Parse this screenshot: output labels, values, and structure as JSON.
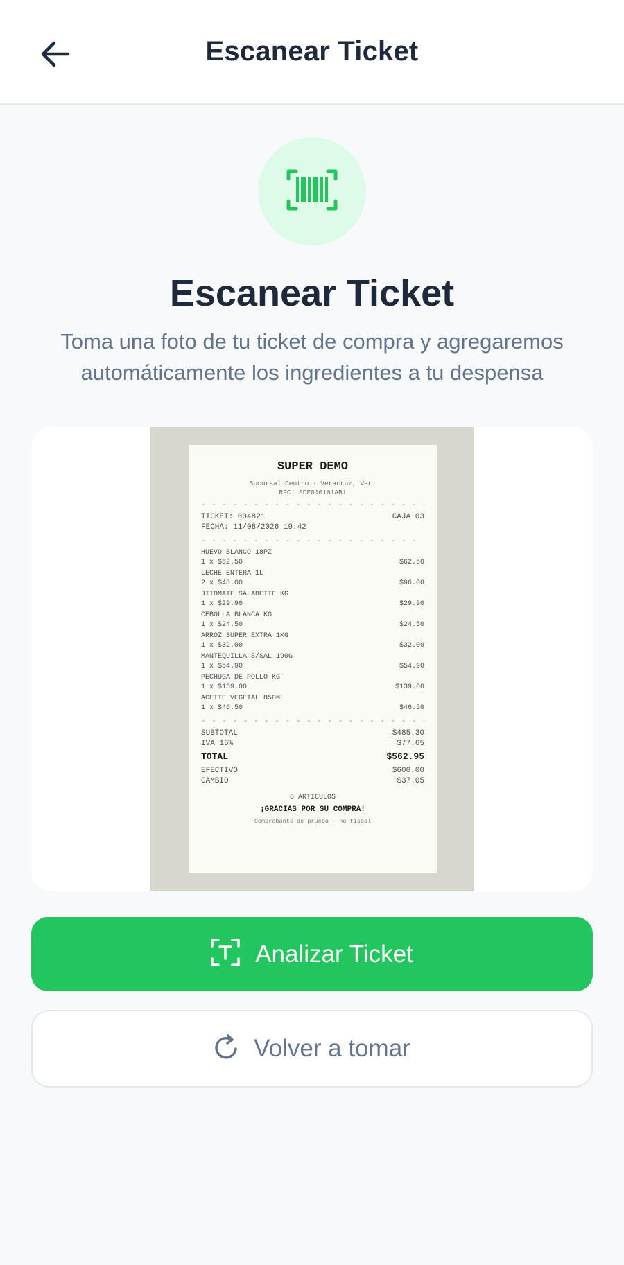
{
  "header": {
    "title": "Escanear Ticket",
    "back_icon": "arrow-left-icon"
  },
  "hero": {
    "icon": "barcode-scan-icon",
    "title": "Escanear Ticket",
    "subtitle": "Toma una foto de tu ticket de compra y agregaremos automáticamente los ingredientes a tu despensa"
  },
  "receipt": {
    "store": "SUPER DEMO",
    "branch": "Sucursal Centro · Veracruz, Ver.",
    "rfc": "RFC: SDE010101AB1",
    "divider": "- - - - - - - - - - - - - - - - - - - - - - -",
    "ticket": "TICKET: 004821",
    "register": "CAJA 03",
    "date": "FECHA: 11/08/2026 19:42",
    "items": [
      {
        "name": "HUEVO BLANCO 18PZ",
        "qty": "1 x $62.50",
        "amount": "$62.50"
      },
      {
        "name": "LECHE ENTERA 1L",
        "qty": "2 x $48.00",
        "amount": "$96.00"
      },
      {
        "name": "JITOMATE SALADETTE KG",
        "qty": "1 x $29.90",
        "amount": "$29.90"
      },
      {
        "name": "CEBOLLA BLANCA KG",
        "qty": "1 x $24.50",
        "amount": "$24.50"
      },
      {
        "name": "ARROZ SUPER EXTRA 1KG",
        "qty": "1 x $32.00",
        "amount": "$32.00"
      },
      {
        "name": "MANTEQUILLA S/SAL 190G",
        "qty": "1 x $54.90",
        "amount": "$54.90"
      },
      {
        "name": "PECHUGA DE POLLO KG",
        "qty": "1 x $139.00",
        "amount": "$139.00"
      },
      {
        "name": "ACEITE VEGETAL 850ML",
        "qty": "1 x $46.50",
        "amount": "$46.50"
      }
    ],
    "subtotal_label": "SUBTOTAL",
    "subtotal": "$485.30",
    "iva_label": "IVA 16%",
    "iva": "$77.65",
    "total_label": "TOTAL",
    "total": "$562.95",
    "cash_label": "EFECTIVO",
    "cash": "$600.00",
    "change_label": "CAMBIO",
    "change": "$37.05",
    "count": "8 ARTICULOS",
    "thanks": "¡GRACIAS POR SU COMPRA!",
    "footer": "Comprobante de prueba — no fiscal"
  },
  "actions": {
    "analyze_label": "Analizar Ticket",
    "analyze_icon": "text-scan-icon",
    "retake_label": "Volver a tomar",
    "retake_icon": "refresh-icon"
  },
  "colors": {
    "accent": "#22c55e",
    "accent_light": "#dcfce7",
    "text": "#1e293b",
    "muted": "#64748b"
  }
}
